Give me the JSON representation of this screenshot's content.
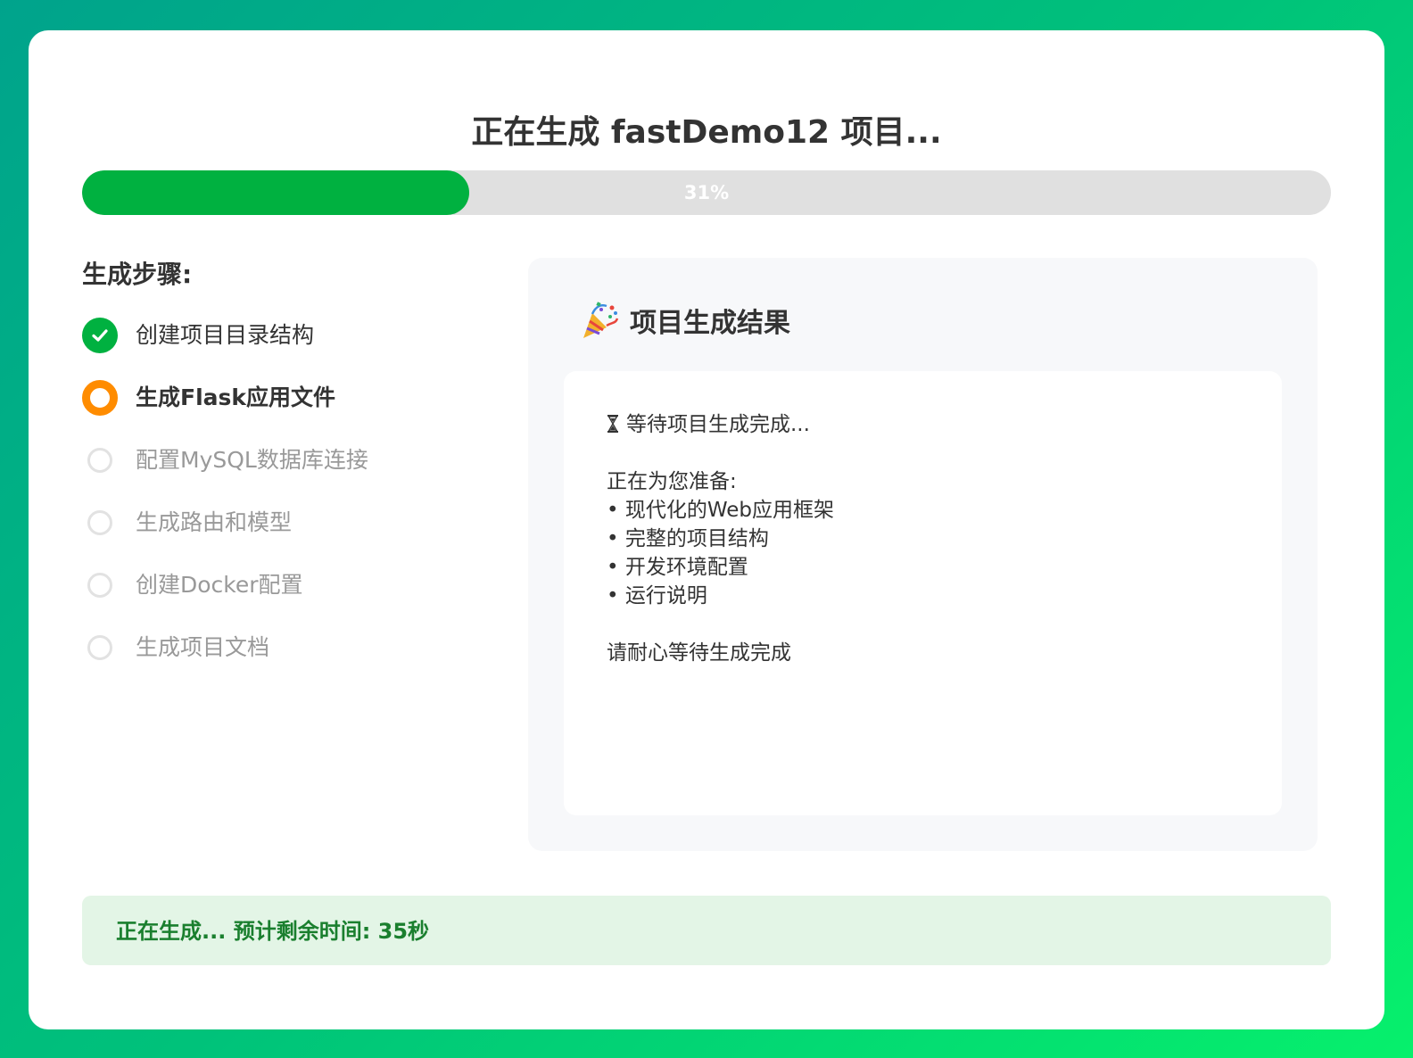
{
  "page": {
    "title": "正在生成 fastDemo12 项目..."
  },
  "progress": {
    "value": 0.31,
    "label": "31%",
    "fill_color": "#00b140",
    "track_color": "#e0e0e0"
  },
  "steps": {
    "title": "生成步骤:",
    "items": [
      {
        "label": "创建项目目录结构",
        "status": "done",
        "icon": "check-icon"
      },
      {
        "label": "生成Flask应用文件",
        "status": "active",
        "icon": "in-progress-ring-icon"
      },
      {
        "label": "配置MySQL数据库连接",
        "status": "pending",
        "icon": "empty-circle-icon"
      },
      {
        "label": "生成路由和模型",
        "status": "pending",
        "icon": "empty-circle-icon"
      },
      {
        "label": "创建Docker配置",
        "status": "pending",
        "icon": "empty-circle-icon"
      },
      {
        "label": "生成项目文档",
        "status": "pending",
        "icon": "empty-circle-icon"
      }
    ],
    "colors": {
      "done": "#00b140",
      "active": "#ff8c00",
      "pending": "#e2e2e2"
    }
  },
  "result": {
    "icon": "party-popper-icon",
    "title": "项目生成结果",
    "waiting_icon": "hourglass-icon",
    "waiting_text": "等待项目生成完成...",
    "preparing_heading": "正在为您准备:",
    "bullets": [
      "• 现代化的Web应用框架",
      "• 完整的项目结构",
      "• 开发环境配置",
      "• 运行说明"
    ],
    "footer_text": "请耐心等待生成完成"
  },
  "status": {
    "text": "正在生成... 预计剩余时间: 35秒",
    "color": "#1a7f2e",
    "background": "#e3f5e6"
  }
}
